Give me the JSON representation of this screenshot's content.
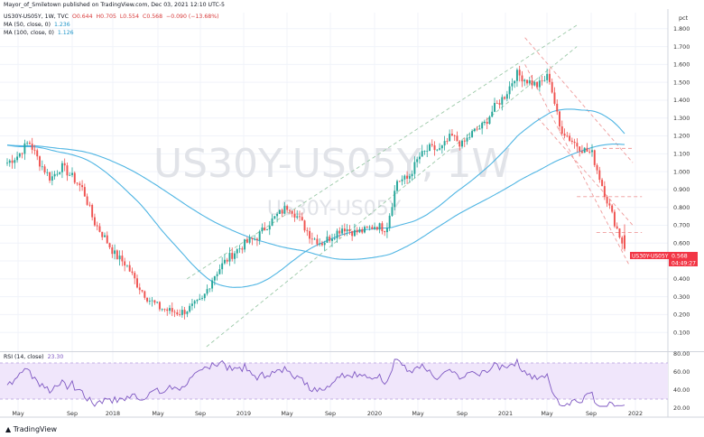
{
  "header": {
    "publisher": "Mayor_of_Smiletown published on TradingView.com, Dec 03, 2021 12:10 UTC-5",
    "symbol": "US30Y-US05Y, 1W, TVC",
    "ohlc": {
      "o": "O0.644",
      "h": "H0.705",
      "l": "L0.554",
      "c": "C0.568",
      "chg": "−0.090 (−13.68%)"
    },
    "ma50": {
      "label": "MA (50, close, 0)",
      "value": "1.236"
    },
    "ma100": {
      "label": "MA (100, close, 0)",
      "value": "1.126"
    },
    "rsi": {
      "label": "RSI (14, close)",
      "value": "23.30"
    }
  },
  "watermark": {
    "big": "US30Y-US05Y, 1W",
    "small": "US30Y-US05Y"
  },
  "branding": {
    "name": "TradingView"
  },
  "price_tag": {
    "symbol": "US30Y-US05Y",
    "value": "0.568",
    "countdown": "04:49:27"
  },
  "chart_data": {
    "type": "candlestick",
    "y_axis_unit": "pct",
    "ylim": [
      0.0,
      1.9
    ],
    "y_ticks": [
      "0.100",
      "0.200",
      "0.300",
      "0.400",
      "0.500",
      "0.600",
      "0.700",
      "0.800",
      "0.900",
      "1.000",
      "1.100",
      "1.200",
      "1.300",
      "1.400",
      "1.500",
      "1.600",
      "1.700",
      "1.800"
    ],
    "x_ticks": [
      "May",
      "Sep",
      "2018",
      "May",
      "Sep",
      "2019",
      "May",
      "Sep",
      "2020",
      "May",
      "Sep",
      "2021",
      "May",
      "Sep",
      "2022"
    ],
    "close_keypoints": [
      [
        "2017-03",
        1.05
      ],
      [
        "2017-04",
        1.09
      ],
      [
        "2017-05",
        1.17
      ],
      [
        "2017-06",
        1.05
      ],
      [
        "2017-07",
        0.96
      ],
      [
        "2017-08",
        1.03
      ],
      [
        "2017-09",
        0.97
      ],
      [
        "2017-10",
        0.9
      ],
      [
        "2017-11",
        0.72
      ],
      [
        "2017-12",
        0.63
      ],
      [
        "2018-01",
        0.53
      ],
      [
        "2018-02",
        0.48
      ],
      [
        "2018-03",
        0.37
      ],
      [
        "2018-04",
        0.29
      ],
      [
        "2018-05",
        0.24
      ],
      [
        "2018-06",
        0.22
      ],
      [
        "2018-07",
        0.21
      ],
      [
        "2018-08",
        0.24
      ],
      [
        "2018-09",
        0.28
      ],
      [
        "2018-10",
        0.41
      ],
      [
        "2018-11",
        0.49
      ],
      [
        "2018-12",
        0.55
      ],
      [
        "2019-01",
        0.6
      ],
      [
        "2019-02",
        0.63
      ],
      [
        "2019-03",
        0.7
      ],
      [
        "2019-04",
        0.76
      ],
      [
        "2019-05",
        0.81
      ],
      [
        "2019-06",
        0.73
      ],
      [
        "2019-07",
        0.64
      ],
      [
        "2019-08",
        0.6
      ],
      [
        "2019-09",
        0.64
      ],
      [
        "2019-10",
        0.69
      ],
      [
        "2019-11",
        0.66
      ],
      [
        "2019-12",
        0.67
      ],
      [
        "2020-01",
        0.7
      ],
      [
        "2020-02",
        0.68
      ],
      [
        "2020-03",
        0.95
      ],
      [
        "2020-04",
        0.96
      ],
      [
        "2020-05",
        1.08
      ],
      [
        "2020-06",
        1.13
      ],
      [
        "2020-07",
        1.12
      ],
      [
        "2020-08",
        1.2
      ],
      [
        "2020-09",
        1.15
      ],
      [
        "2020-10",
        1.22
      ],
      [
        "2020-11",
        1.26
      ],
      [
        "2020-12",
        1.36
      ],
      [
        "2021-01",
        1.43
      ],
      [
        "2021-02",
        1.55
      ],
      [
        "2021-03",
        1.51
      ],
      [
        "2021-04",
        1.48
      ],
      [
        "2021-05",
        1.54
      ],
      [
        "2021-06",
        1.25
      ],
      [
        "2021-07",
        1.18
      ],
      [
        "2021-08",
        1.13
      ],
      [
        "2021-09",
        1.1
      ],
      [
        "2021-10",
        0.91
      ],
      [
        "2021-11",
        0.73
      ],
      [
        "2021-12",
        0.568
      ]
    ],
    "moving_averages": [
      {
        "name": "MA (50, close, 0)",
        "color": "#4fb5e3",
        "last": 1.236
      },
      {
        "name": "MA (100, close, 0)",
        "color": "#4fb5e3",
        "last": 1.126
      }
    ],
    "rsi": {
      "ylim": [
        20,
        80
      ],
      "ticks": [
        "20.00",
        "40.00",
        "60.00",
        "80.00"
      ],
      "band": [
        30,
        70
      ],
      "last": 23.3
    }
  }
}
